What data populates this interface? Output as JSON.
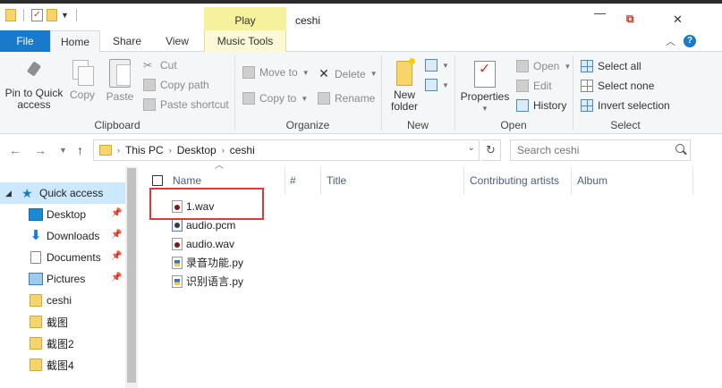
{
  "window": {
    "title": "ceshi",
    "context_tab": "Play",
    "accent": "#1979ca",
    "context_tab_color": "#f5f19d",
    "highlight_color": "#d93a3a"
  },
  "tabs": {
    "file": "File",
    "home": "Home",
    "share": "Share",
    "view": "View",
    "music_tools": "Music Tools"
  },
  "ribbon": {
    "clipboard": {
      "label": "Clipboard",
      "pin": "Pin to Quick access",
      "copy": "Copy",
      "paste": "Paste",
      "cut": "Cut",
      "copy_path": "Copy path",
      "paste_shortcut": "Paste shortcut"
    },
    "organize": {
      "label": "Organize",
      "move_to": "Move to",
      "copy_to": "Copy to",
      "delete": "Delete",
      "rename": "Rename"
    },
    "new": {
      "label": "New",
      "new_folder": "New folder"
    },
    "open": {
      "label": "Open",
      "properties": "Properties",
      "open": "Open",
      "edit": "Edit",
      "history": "History"
    },
    "select": {
      "label": "Select",
      "select_all": "Select all",
      "select_none": "Select none",
      "invert": "Invert selection"
    }
  },
  "address": {
    "crumbs": [
      "This PC",
      "Desktop",
      "ceshi"
    ],
    "search_placeholder": "Search ceshi"
  },
  "nav": {
    "quick_access": "Quick access",
    "items": [
      {
        "label": "Desktop",
        "icon": "desktop-icon",
        "pinned": true
      },
      {
        "label": "Downloads",
        "icon": "downloads-icon",
        "pinned": true
      },
      {
        "label": "Documents",
        "icon": "documents-icon",
        "pinned": true
      },
      {
        "label": "Pictures",
        "icon": "pictures-icon",
        "pinned": true
      },
      {
        "label": "ceshi",
        "icon": "folder-icon",
        "pinned": false
      },
      {
        "label": "截图",
        "icon": "folder-icon",
        "pinned": false
      },
      {
        "label": "截图2",
        "icon": "folder-icon",
        "pinned": false
      },
      {
        "label": "截图4",
        "icon": "folder-icon",
        "pinned": false
      }
    ]
  },
  "columns": [
    "Name",
    "#",
    "Title",
    "Contributing artists",
    "Album"
  ],
  "files": [
    {
      "name": "1.wav",
      "icon": "wav-file-icon"
    },
    {
      "name": "audio.pcm",
      "icon": "pcm-file-icon"
    },
    {
      "name": "audio.wav",
      "icon": "wav-file-icon"
    },
    {
      "name": "录音功能.py",
      "icon": "python-file-icon"
    },
    {
      "name": "识别语言.py",
      "icon": "python-file-icon"
    }
  ]
}
